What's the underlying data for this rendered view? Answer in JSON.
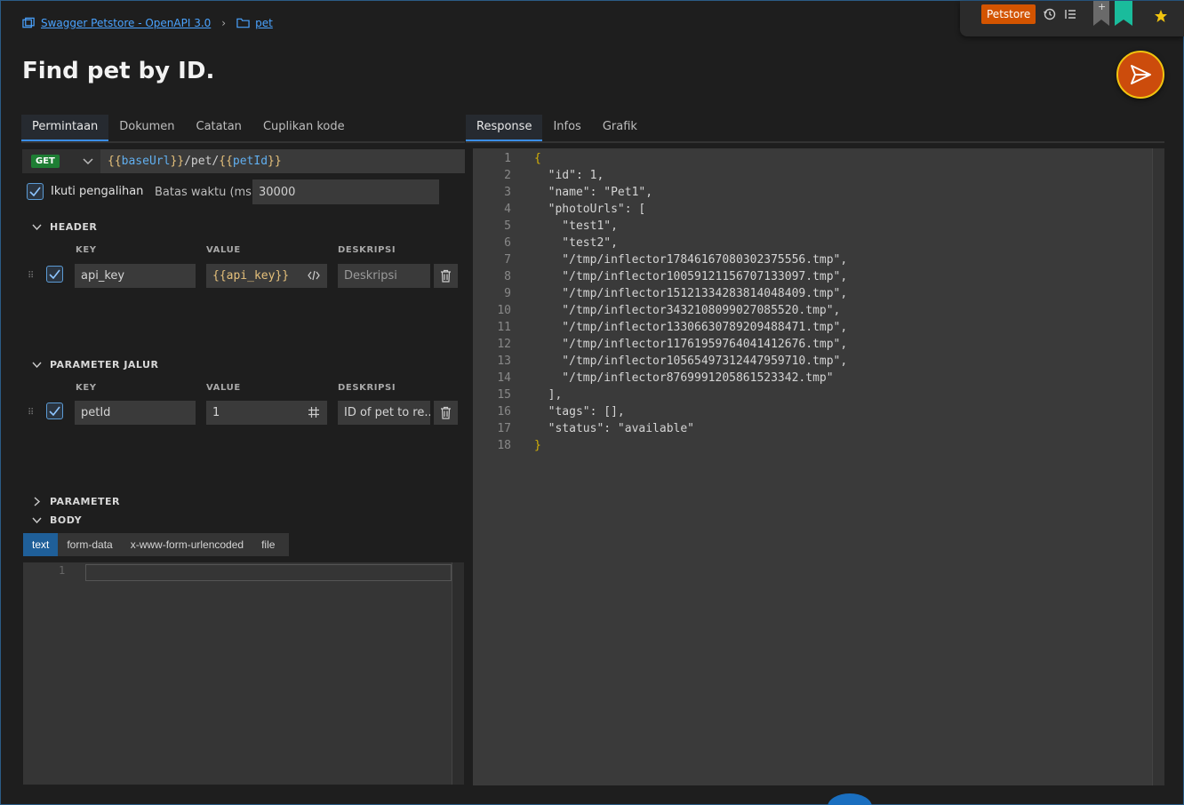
{
  "breadcrumb": {
    "collection": "Swagger Petstore - OpenAPI 3.0",
    "folder": "pet"
  },
  "page_title": "Find pet by ID.",
  "toolbar": {
    "environment": "Petstore",
    "plus": "+"
  },
  "left_tabs": [
    {
      "label": "Permintaan"
    },
    {
      "label": "Dokumen"
    },
    {
      "label": "Catatan"
    },
    {
      "label": "Cuplikan kode"
    }
  ],
  "right_tabs": [
    {
      "label": "Response"
    },
    {
      "label": "Infos"
    },
    {
      "label": "Grafik"
    }
  ],
  "request": {
    "method": "GET",
    "url_open1": "{{",
    "url_var1": "baseUrl",
    "url_close1": "}}",
    "url_mid": "/pet/",
    "url_open2": "{{",
    "url_var2": "petId",
    "url_close2": "}}",
    "follow_redirects_label": "Ikuti pengalihan",
    "timeout_label": "Batas waktu (ms)",
    "timeout_value": "30000"
  },
  "header_section": {
    "title": "HEADER",
    "col_key": "KEY",
    "col_value": "VALUE",
    "col_desc": "DESKRIPSI",
    "row": {
      "key": "api_key",
      "value": "{{api_key}}",
      "desc_placeholder": "Deskripsi"
    }
  },
  "path_section": {
    "title": "PARAMETER JALUR",
    "col_key": "KEY",
    "col_value": "VALUE",
    "col_desc": "DESKRIPSI",
    "row": {
      "key": "petId",
      "value": "1",
      "desc": "ID of pet to re..."
    }
  },
  "param_section": {
    "title": "PARAMETER"
  },
  "body_section": {
    "title": "BODY",
    "tabs": [
      {
        "label": "text"
      },
      {
        "label": "form-data"
      },
      {
        "label": "x-www-form-urlencoded"
      },
      {
        "label": "file"
      }
    ],
    "line_number": "1"
  },
  "response": {
    "lines": [
      "{",
      "  \"id\": 1,",
      "  \"name\": \"Pet1\",",
      "  \"photoUrls\": [",
      "    \"test1\",",
      "    \"test2\",",
      "    \"/tmp/inflector17846167080302375556.tmp\",",
      "    \"/tmp/inflector10059121156707133097.tmp\",",
      "    \"/tmp/inflector15121334283814048409.tmp\",",
      "    \"/tmp/inflector3432108099027085520.tmp\",",
      "    \"/tmp/inflector13306630789209488471.tmp\",",
      "    \"/tmp/inflector11761959764041412676.tmp\",",
      "    \"/tmp/inflector10565497312447959710.tmp\",",
      "    \"/tmp/inflector8769991205861523342.tmp\"",
      "  ],",
      "  \"tags\": [],",
      "  \"status\": \"available\"",
      "}"
    ]
  },
  "colors": {
    "accent_blue": "#3a8ee6",
    "send_orange": "#cc4c0c",
    "env_orange": "#d35400",
    "get_green": "#1e7e34",
    "bookmark_teal": "#1abc9c"
  }
}
